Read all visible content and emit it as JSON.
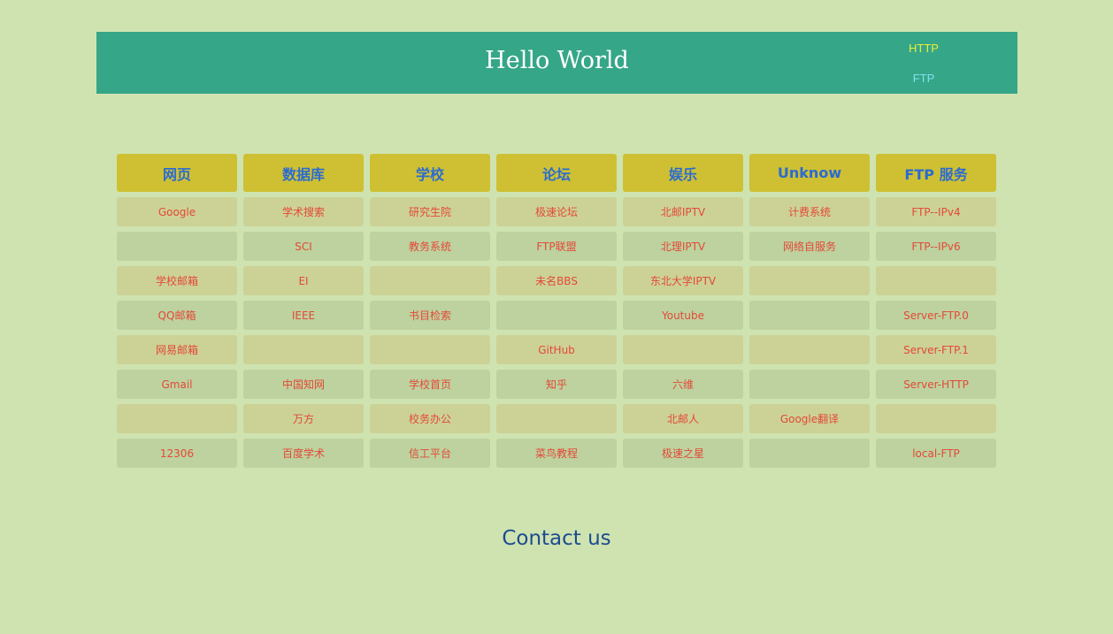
{
  "header": {
    "title": "Hello World",
    "links": [
      "HTTP",
      "FTP"
    ]
  },
  "table": {
    "headers": [
      "网页",
      "数据库",
      "学校",
      "论坛",
      "娱乐",
      "Unknow",
      "FTP 服务"
    ],
    "rows": [
      [
        "Google",
        "学术搜索",
        "研究生院",
        "极速论坛",
        "北邮IPTV",
        "计费系统",
        "FTP--IPv4"
      ],
      [
        "",
        "SCI",
        "教务系统",
        "FTP联盟",
        "北理IPTV",
        "网络自服务",
        "FTP--IPv6"
      ],
      [
        "学校邮箱",
        "EI",
        "",
        "未名BBS",
        "东北大学IPTV",
        "",
        ""
      ],
      [
        "QQ邮箱",
        "IEEE",
        "书目检索",
        "",
        "Youtube",
        "",
        "Server-FTP.0"
      ],
      [
        "网易邮箱",
        "",
        "",
        "GitHub",
        "",
        "",
        "Server-FTP.1"
      ],
      [
        "Gmail",
        "中国知网",
        "学校首页",
        "知乎",
        "六维",
        "",
        "Server-HTTP"
      ],
      [
        "",
        "万方",
        "校务办公",
        "",
        "北邮人",
        "Google翻译",
        ""
      ],
      [
        "12306",
        "百度学术",
        "信工平台",
        "菜鸟教程",
        "极速之星",
        "",
        "local-FTP"
      ]
    ]
  },
  "footer": {
    "contact": "Contact us"
  },
  "colors": {
    "background": "#cfe3b1",
    "header_bg": "#36a688",
    "header_cell_bg": "#cec032",
    "header_cell_text": "#2b6bd1",
    "cell_text": "#e4483a",
    "row_odd_bg": "#ccd295",
    "row_even_bg": "#bdd29e",
    "contact_text": "#1c4b8f"
  }
}
